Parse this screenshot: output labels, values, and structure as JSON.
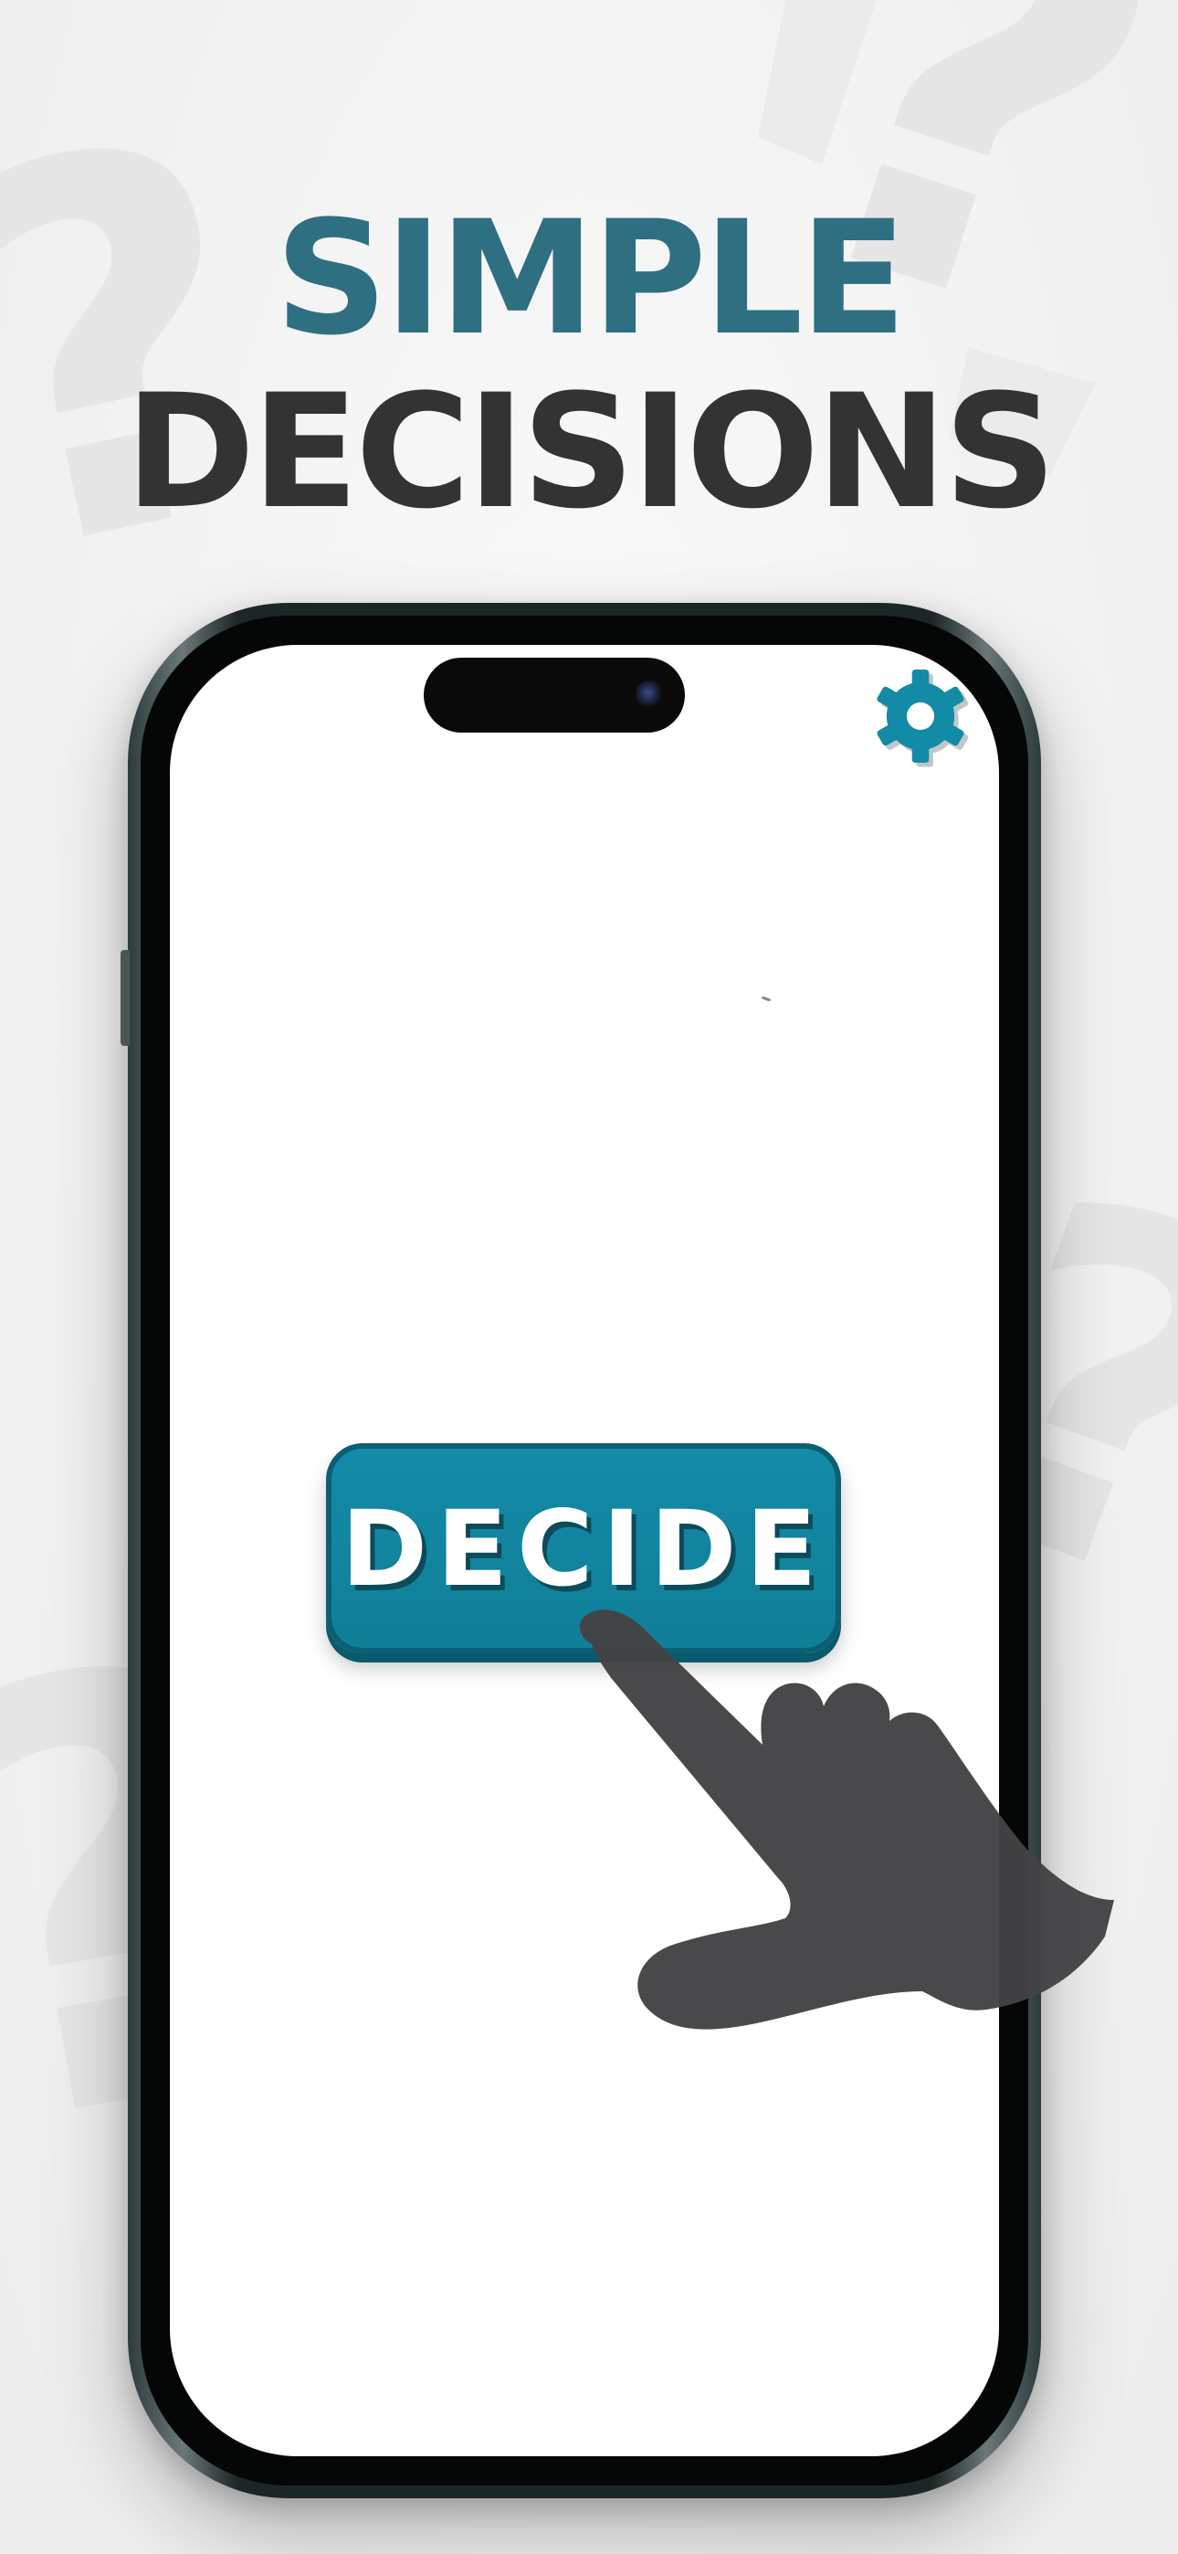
{
  "headline": {
    "line1": "SIMPLE",
    "line2": "DECISIONS"
  },
  "screen": {
    "settings_icon": "gear-icon",
    "decide_button_label": "DECIDE",
    "hand_icon": "pointing-hand-icon"
  },
  "colors": {
    "accent": "#138aa6",
    "headline_accent": "#2f6f82",
    "headline_dark": "#333333",
    "hand": "#434345"
  }
}
